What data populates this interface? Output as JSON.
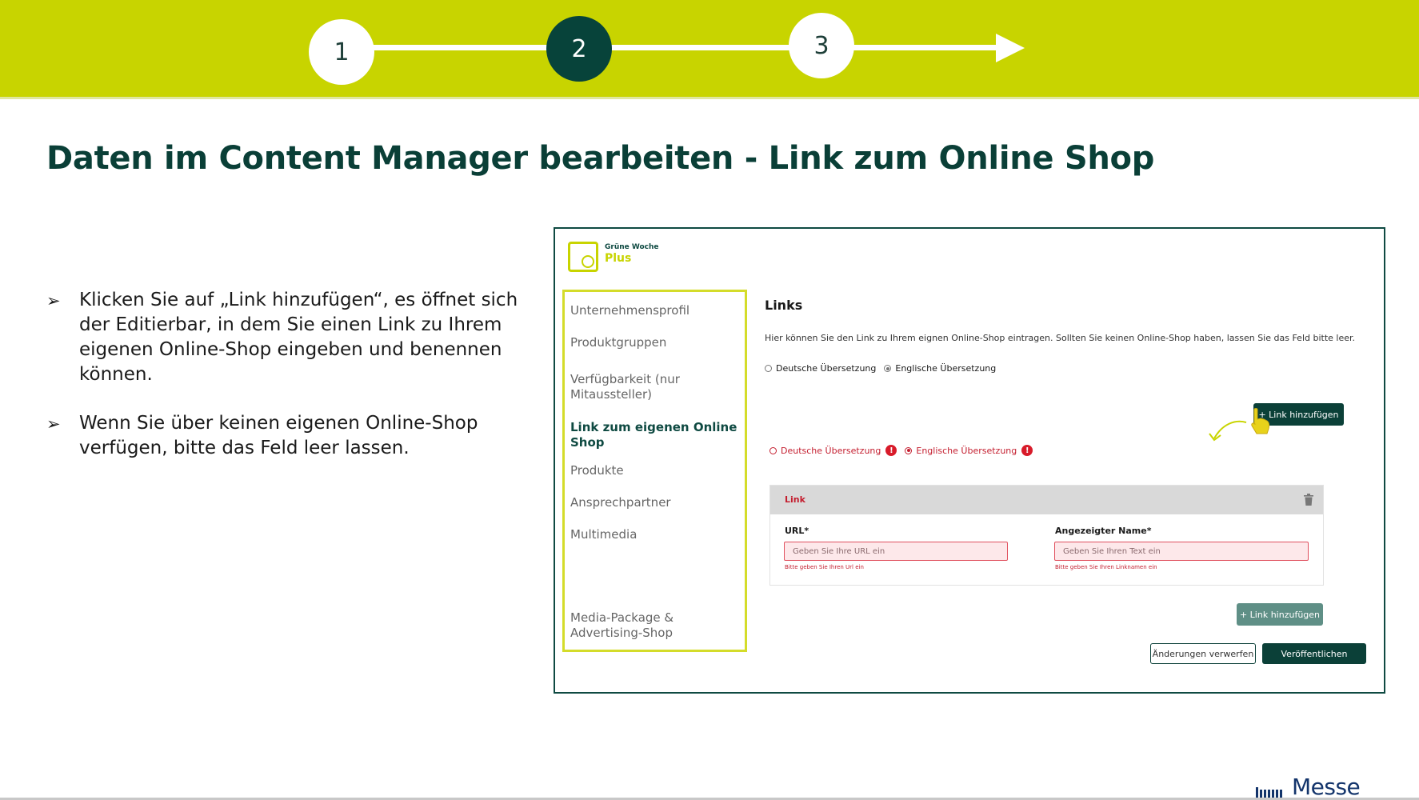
{
  "steps": [
    "1",
    "2",
    "3"
  ],
  "active_step": "2",
  "slide_title": "Daten im Content Manager bearbeiten - Link zum Online Shop",
  "bullets": [
    "Klicken Sie auf „Link hinzufügen“, es öffnet sich der Editierbar, in dem Sie einen Link zu Ihrem eigenen Online-Shop eingeben und benennen können.",
    "Wenn Sie über keinen eigenen Online-Shop verfügen, bitte das Feld leer lassen."
  ],
  "app": {
    "logo_small": "Grüne Woche",
    "logo_big": "Plus",
    "sidebar": [
      "Unternehmensprofil",
      "Produktgruppen",
      "Verfügbarkeit (nur Mitaussteller)",
      "Link zum eigenen Online Shop",
      "Produkte",
      "Ansprechpartner",
      "Multimedia",
      "Media-Package & Advertising-Shop"
    ],
    "current_item": "Link zum eigenen Online Shop",
    "section_title": "Links",
    "description": "Hier können Sie den Link zu Ihrem eignen Online-Shop eintragen. Sollten Sie keinen Online-Shop haben, lassen Sie das Feld bitte leer.",
    "lang_top": {
      "de": "Deutsche Übersetzung",
      "en": "Englische Übersetzung",
      "selected": "en"
    },
    "add_link_top": "+ Link hinzufügen",
    "lang_error": {
      "de": "Deutsche Übersetzung",
      "en": "Englische Übersetzung",
      "selected": "en",
      "warn": "!"
    },
    "card": {
      "title": "Link",
      "url_label": "URL*",
      "url_placeholder": "Geben Sie Ihre URL ein",
      "url_hint": "Bitte geben Sie Ihren Url ein",
      "name_label": "Angezeigter Name*",
      "name_placeholder": "Geben Sie Ihren Text ein",
      "name_hint": "Bitte geben Sie Ihren Linknamen ein"
    },
    "add_link_bottom": "+ Link hinzufügen",
    "discard": "Änderungen verwerfen",
    "publish": "Veröffentlichen"
  },
  "footer_logo": "Messe Berlin",
  "colors": {
    "lime": "#c8d400",
    "dark_green": "#07433a",
    "error_red": "#c41e2f",
    "messe_blue": "#13346b"
  }
}
